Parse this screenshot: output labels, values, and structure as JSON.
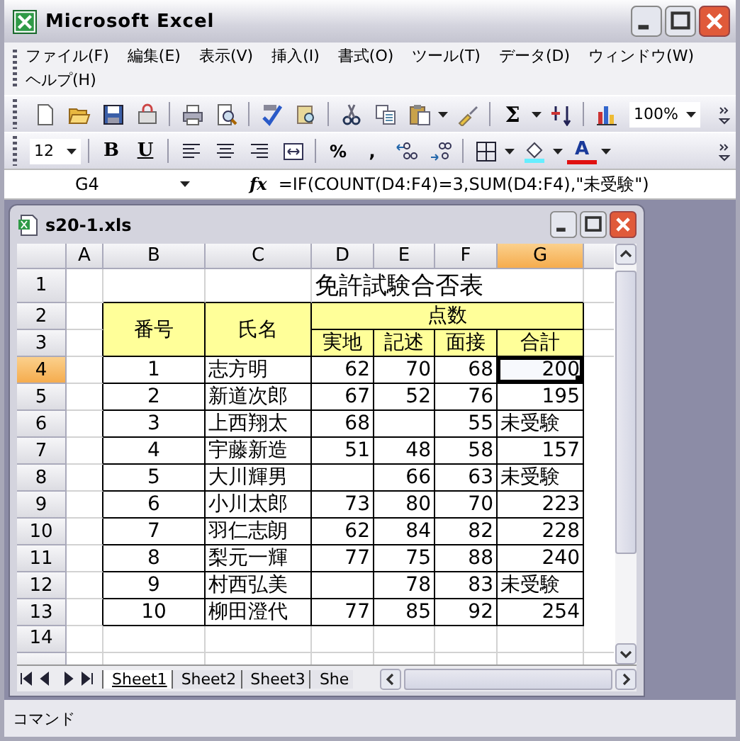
{
  "window": {
    "title": "Microsoft Excel"
  },
  "menu": [
    "ファイル(F)",
    "編集(E)",
    "表示(V)",
    "挿入(I)",
    "書式(O)",
    "ツール(T)",
    "データ(D)",
    "ウィンドウ(W)",
    "ヘルプ(H)"
  ],
  "standard_toolbar": {
    "sum": "Σ",
    "zoom": "100%"
  },
  "format_toolbar": {
    "font_size": "12",
    "bold": "B",
    "underline": "U",
    "percent": "%",
    "comma": ",",
    "font_color": "A"
  },
  "formula_bar": {
    "name_box": "G4",
    "function_label": "fx",
    "formula": "=IF(COUNT(D4:F4)=3,SUM(D4:F4),\"未受験\")"
  },
  "workbook": {
    "title": "s20-1.xls"
  },
  "columns": [
    {
      "label": "A",
      "selected": false
    },
    {
      "label": "B",
      "selected": false
    },
    {
      "label": "C",
      "selected": false
    },
    {
      "label": "D",
      "selected": false
    },
    {
      "label": "E",
      "selected": false
    },
    {
      "label": "F",
      "selected": false
    },
    {
      "label": "G",
      "selected": true
    }
  ],
  "row_headers": [
    {
      "label": "1",
      "selected": false
    },
    {
      "label": "2",
      "selected": false
    },
    {
      "label": "3",
      "selected": false
    },
    {
      "label": "4",
      "selected": true
    },
    {
      "label": "5",
      "selected": false
    },
    {
      "label": "6",
      "selected": false
    },
    {
      "label": "7",
      "selected": false
    },
    {
      "label": "8",
      "selected": false
    },
    {
      "label": "9",
      "selected": false
    },
    {
      "label": "10",
      "selected": false
    },
    {
      "label": "11",
      "selected": false
    },
    {
      "label": "12",
      "selected": false
    },
    {
      "label": "13",
      "selected": false
    },
    {
      "label": "14",
      "selected": false
    }
  ],
  "sheet": {
    "title": "免許試験合否表",
    "number_header": "番号",
    "name_header": "氏名",
    "score_group": "点数",
    "score_headers": [
      "実地",
      "記述",
      "面接",
      "合計"
    ],
    "records": [
      {
        "number": "1",
        "name": "志方明",
        "practical": "62",
        "written": "70",
        "interview": "68",
        "total": {
          "value": "200",
          "kind": "number"
        },
        "active": true
      },
      {
        "number": "2",
        "name": "新道次郎",
        "practical": "67",
        "written": "52",
        "interview": "76",
        "total": {
          "value": "195",
          "kind": "number"
        },
        "active": false
      },
      {
        "number": "3",
        "name": "上西翔太",
        "practical": "68",
        "interview": "55",
        "total": {
          "value": "未受験",
          "kind": "text"
        },
        "active": false
      },
      {
        "number": "4",
        "name": "宇藤新造",
        "practical": "51",
        "written": "48",
        "interview": "58",
        "total": {
          "value": "157",
          "kind": "number"
        },
        "active": false
      },
      {
        "number": "5",
        "name": "大川輝男",
        "written": "66",
        "interview": "63",
        "total": {
          "value": "未受験",
          "kind": "text"
        },
        "active": false
      },
      {
        "number": "6",
        "name": "小川太郎",
        "practical": "73",
        "written": "80",
        "interview": "70",
        "total": {
          "value": "223",
          "kind": "number"
        },
        "active": false
      },
      {
        "number": "7",
        "name": "羽仁志朗",
        "practical": "62",
        "written": "84",
        "interview": "82",
        "total": {
          "value": "228",
          "kind": "number"
        },
        "active": false
      },
      {
        "number": "8",
        "name": "梨元一輝",
        "practical": "77",
        "written": "75",
        "interview": "88",
        "total": {
          "value": "240",
          "kind": "number"
        },
        "active": false
      },
      {
        "number": "9",
        "name": "村西弘美",
        "written": "78",
        "interview": "83",
        "total": {
          "value": "未受験",
          "kind": "text"
        },
        "active": false
      },
      {
        "number": "10",
        "name": "柳田澄代",
        "practical": "77",
        "written": "85",
        "interview": "92",
        "total": {
          "value": "254",
          "kind": "number"
        },
        "active": false
      }
    ]
  },
  "sheet_tabs": [
    {
      "label": "Sheet1",
      "selected": true
    },
    {
      "label": "Sheet2",
      "selected": false
    },
    {
      "label": "Sheet3",
      "selected": false
    },
    {
      "label": "She",
      "selected": false
    }
  ],
  "status_bar": "コマンド"
}
